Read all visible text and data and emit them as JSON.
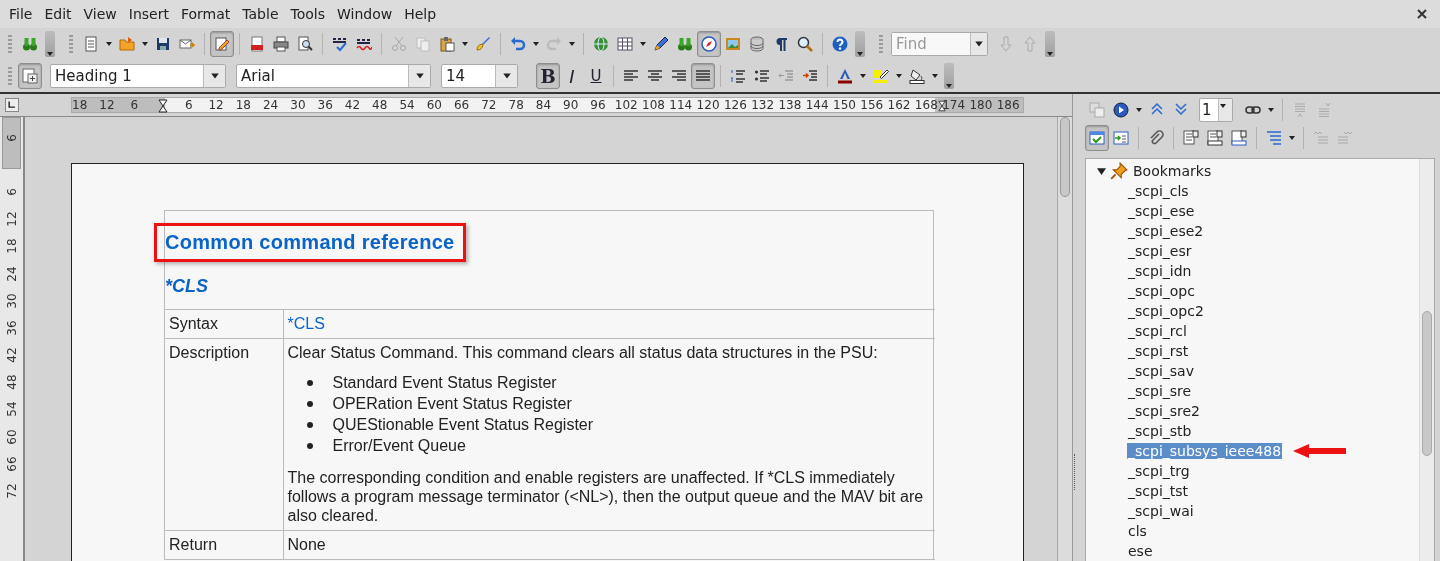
{
  "menu": [
    {
      "label": "File"
    },
    {
      "label": "Edit"
    },
    {
      "label": "View"
    },
    {
      "label": "Insert"
    },
    {
      "label": "Format"
    },
    {
      "label": "Table"
    },
    {
      "label": "Tools"
    },
    {
      "label": "Window"
    },
    {
      "label": "Help"
    }
  ],
  "toolbar": {
    "edit_mode": true,
    "navigator": true,
    "find": {
      "placeholder": "Find"
    }
  },
  "formatting": {
    "styles_window": true,
    "paragraph_style": "Heading 1",
    "font_name": "Arial",
    "font_size": "14",
    "bold": {
      "label": "B",
      "on": true
    },
    "italic": {
      "label": "I",
      "on": false
    },
    "underline": {
      "label": "U",
      "on": false
    },
    "alignment": [
      {
        "kind": "left",
        "selected": false
      },
      {
        "kind": "center",
        "selected": false
      },
      {
        "kind": "right",
        "selected": false
      },
      {
        "kind": "justify",
        "selected": true
      }
    ]
  },
  "ruler": {
    "horizontal_margin_marks": [
      "18",
      "12",
      "6"
    ],
    "horizontal_marks": [
      "6",
      "12",
      "18",
      "24",
      "30",
      "36",
      "42",
      "48",
      "54",
      "60",
      "66",
      "72",
      "78",
      "84",
      "90",
      "96",
      "102",
      "108",
      "114",
      "120",
      "126",
      "132",
      "138",
      "144",
      "150",
      "156",
      "162",
      "168",
      "174",
      "180",
      "186"
    ],
    "vertical_margin_marks": [
      "6"
    ],
    "vertical_marks": [
      "6",
      "12",
      "18",
      "24",
      "30",
      "36",
      "42",
      "48",
      "54",
      "60",
      "66",
      "72"
    ]
  },
  "document": {
    "heading": {
      "text": "Common command reference",
      "highlighted": true
    },
    "subheading": "*CLS",
    "rows": [
      {
        "label": "Syntax",
        "kind": "code",
        "text": "*CLS"
      },
      {
        "label": "Description",
        "kind": "list",
        "intro": "Clear Status Command. This command clears all status data structures in the PSU:",
        "bullets": [
          "Standard Event Status Register",
          "OPERation Event Status Register",
          "QUEStionable Event Status Register",
          "Error/Event Queue"
        ],
        "outro": "The corresponding condition and enable registers are unaffected. If *CLS immediately follows a program message terminator (<NL>), then the output queue and the MAV bit are also cleared."
      },
      {
        "label": "Return",
        "kind": "plain",
        "text": "None"
      }
    ]
  },
  "navigator": {
    "page": "1",
    "content_view": true,
    "tree": [
      {
        "label": "Bookmarks",
        "expanded": true,
        "children": [
          {
            "label": "_scpi_cls",
            "selected": false,
            "pointed": false
          },
          {
            "label": "_scpi_ese",
            "selected": false,
            "pointed": false
          },
          {
            "label": "_scpi_ese2",
            "selected": false,
            "pointed": false
          },
          {
            "label": "_scpi_esr",
            "selected": false,
            "pointed": false
          },
          {
            "label": "_scpi_idn",
            "selected": false,
            "pointed": false
          },
          {
            "label": "_scpi_opc",
            "selected": false,
            "pointed": false
          },
          {
            "label": "_scpi_opc2",
            "selected": false,
            "pointed": false
          },
          {
            "label": "_scpi_rcl",
            "selected": false,
            "pointed": false
          },
          {
            "label": "_scpi_rst",
            "selected": false,
            "pointed": false
          },
          {
            "label": "_scpi_sav",
            "selected": false,
            "pointed": false
          },
          {
            "label": "_scpi_sre",
            "selected": false,
            "pointed": false
          },
          {
            "label": "_scpi_sre2",
            "selected": false,
            "pointed": false
          },
          {
            "label": "_scpi_stb",
            "selected": false,
            "pointed": false
          },
          {
            "label": "_scpi_subsys_ieee488",
            "selected": true,
            "pointed": true
          },
          {
            "label": "_scpi_trg",
            "selected": false,
            "pointed": false
          },
          {
            "label": "_scpi_tst",
            "selected": false,
            "pointed": false
          },
          {
            "label": "_scpi_wai",
            "selected": false,
            "pointed": false
          },
          {
            "label": "cls",
            "selected": false,
            "pointed": false
          },
          {
            "label": "ese",
            "selected": false,
            "pointed": false
          }
        ]
      }
    ]
  }
}
